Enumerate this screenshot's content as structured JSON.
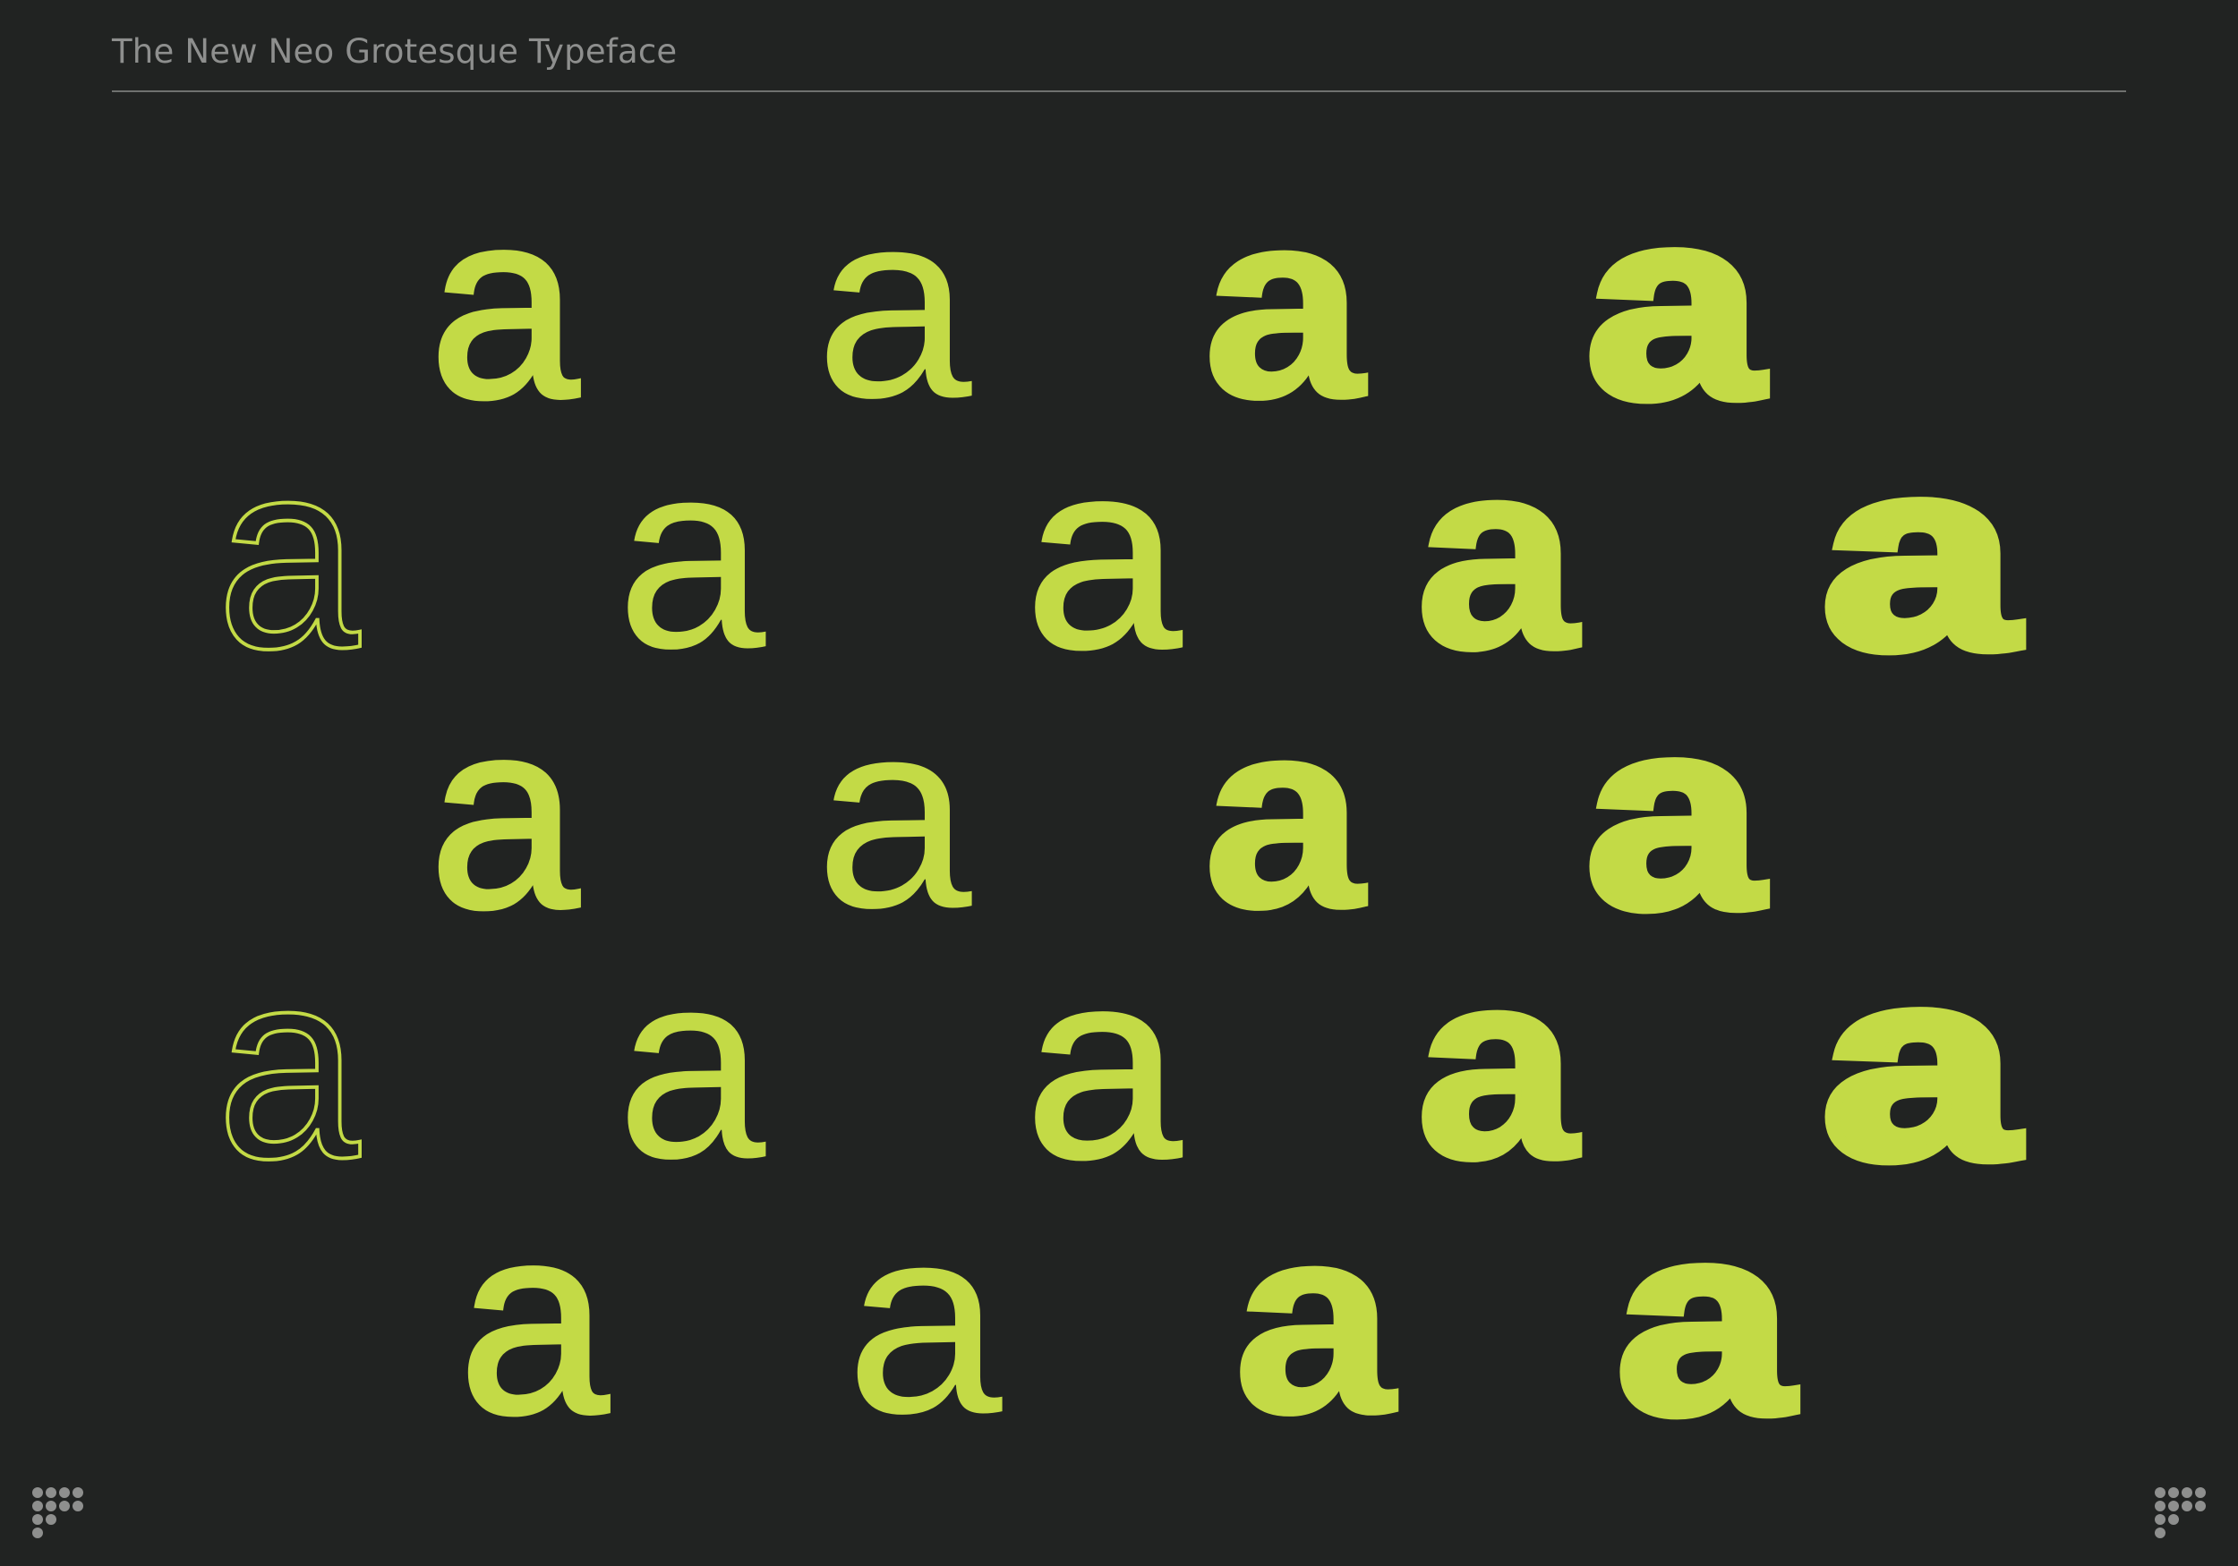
{
  "header": {
    "title": "The New Neo Grotesque Typeface"
  },
  "specimen": {
    "glyph": "a",
    "color": "#c3da46",
    "rows": [
      [
        "a",
        "a",
        "a",
        "a"
      ],
      [
        "a",
        "a",
        "a",
        "a",
        "a"
      ],
      [
        "a",
        "a",
        "a",
        "a"
      ],
      [
        "a",
        "a",
        "a",
        "a",
        "a"
      ],
      [
        "a",
        "a",
        "a",
        "a"
      ]
    ]
  },
  "footer": {
    "left_mark": "logo-mark",
    "right_mark": "logo-mark",
    "mark_color": "#8e8f8e"
  }
}
